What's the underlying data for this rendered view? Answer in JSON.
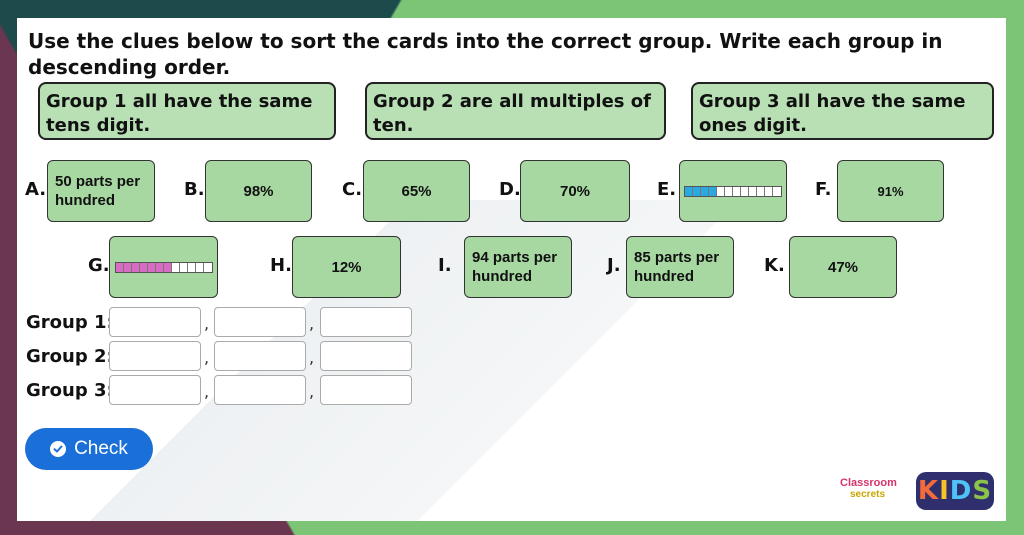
{
  "question": "Use the clues below to sort the cards into the correct group. Write each group in descending order.",
  "clues": [
    "Group 1 all have the same tens digit.",
    "Group 2 are all multiples of ten.",
    "Group 3 all have the same ones digit."
  ],
  "cards": [
    {
      "letter": "A.",
      "type": "text",
      "line1": "50 parts per",
      "line2": "hundred"
    },
    {
      "letter": "B.",
      "type": "value",
      "value": "98%"
    },
    {
      "letter": "C.",
      "type": "value",
      "value": "65%"
    },
    {
      "letter": "D.",
      "type": "value",
      "value": "70%"
    },
    {
      "letter": "E.",
      "type": "bar",
      "filled": 4,
      "total": 12,
      "fill_color": "#29a9df"
    },
    {
      "letter": "F.",
      "type": "value",
      "value": "91%"
    },
    {
      "letter": "G.",
      "type": "bar",
      "filled": 7,
      "total": 12,
      "fill_color": "#d96bc4"
    },
    {
      "letter": "H.",
      "type": "value",
      "value": "12%"
    },
    {
      "letter": "I.",
      "type": "text",
      "line1": "94 parts per",
      "line2": "hundred"
    },
    {
      "letter": "J.",
      "type": "text",
      "line1": "85 parts per",
      "line2": "hundred"
    },
    {
      "letter": "K.",
      "type": "value",
      "value": "47%"
    }
  ],
  "groups": [
    {
      "label": "Group 1:",
      "values": [
        "",
        "",
        ""
      ]
    },
    {
      "label": "Group 2:",
      "values": [
        "",
        "",
        ""
      ]
    },
    {
      "label": "Group 3:",
      "values": [
        "",
        "",
        ""
      ]
    }
  ],
  "separator": ",",
  "check_button": {
    "label": "Check",
    "icon": "check-circle-icon"
  },
  "logo": {
    "line1": "Classroom",
    "line2": "secrets",
    "kids": "KIDS"
  },
  "colors": {
    "card_fill": "#a7d8a2",
    "clue_fill": "#b8e0b4",
    "button": "#1a6fd9",
    "frame_green": "#7cc576"
  }
}
